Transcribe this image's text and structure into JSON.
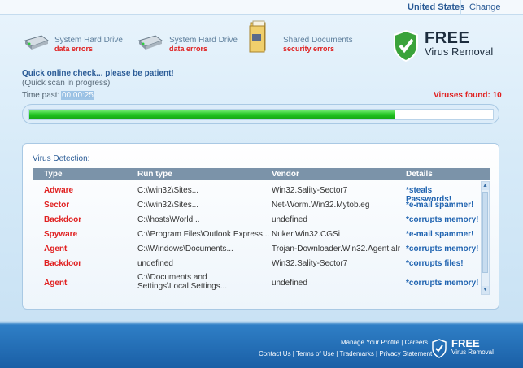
{
  "topbar": {
    "country": "United States",
    "change_label": "Change"
  },
  "status_items": [
    {
      "name": "System Hard Drive",
      "status": "data errors",
      "icon": "hard-drive-icon"
    },
    {
      "name": "System Hard Drive",
      "status": "data errors",
      "icon": "hard-drive-icon"
    },
    {
      "name": "Shared Documents",
      "status": "security errors",
      "icon": "documents-folder-icon"
    }
  ],
  "logo": {
    "free": "FREE",
    "sub": "Virus Removal",
    "icon": "shield-check-icon"
  },
  "scan": {
    "title": "Quick online check... please be patient!",
    "subtitle": "(Quick scan in progress)",
    "time_label": "Time past:",
    "time_value": "00:00:25",
    "viruses_found": "Viruses found: 10",
    "progress": 0.79
  },
  "detection": {
    "title": "Virus Detection:",
    "columns": [
      "Type",
      "Run type",
      "Vendor",
      "Details"
    ],
    "rows": [
      {
        "type": "Adware",
        "run": "C:\\\\win32\\Sites...",
        "vendor": "Win32.Sality-Sector7",
        "details": "*steals Passwords!"
      },
      {
        "type": "Sector",
        "run": "C:\\\\win32\\Sites...",
        "vendor": "Net-Worm.Win32.Mytob.eg",
        "details": "*e-mail spammer!"
      },
      {
        "type": "Backdoor",
        "run": "C:\\\\hosts\\World...",
        "vendor": "undefined",
        "details": "*corrupts memory!"
      },
      {
        "type": "Spyware",
        "run": "C:\\\\Program Files\\Outlook Express...",
        "vendor": "Nuker.Win32.CGSi",
        "details": "*e-mail spammer!"
      },
      {
        "type": "Agent",
        "run": "C:\\\\Windows\\Documents...",
        "vendor": "Trojan-Downloader.Win32.Agent.alr",
        "details": "*corrupts memory!"
      },
      {
        "type": "Backdoor",
        "run": "undefined",
        "vendor": "Win32.Sality-Sector7",
        "details": "*corrupts files!"
      },
      {
        "type": "Agent",
        "run": "C:\\\\Documents and Settings\\Local Settings...",
        "vendor": "undefined",
        "details": "*corrupts memory!"
      }
    ]
  },
  "footer": {
    "line1": "Manage Your Profile | Careers",
    "line2": "Contact Us | Terms of Use | Trademarks | Privacy Statement",
    "logo_free": "FREE",
    "logo_sub": "Virus Removal"
  }
}
